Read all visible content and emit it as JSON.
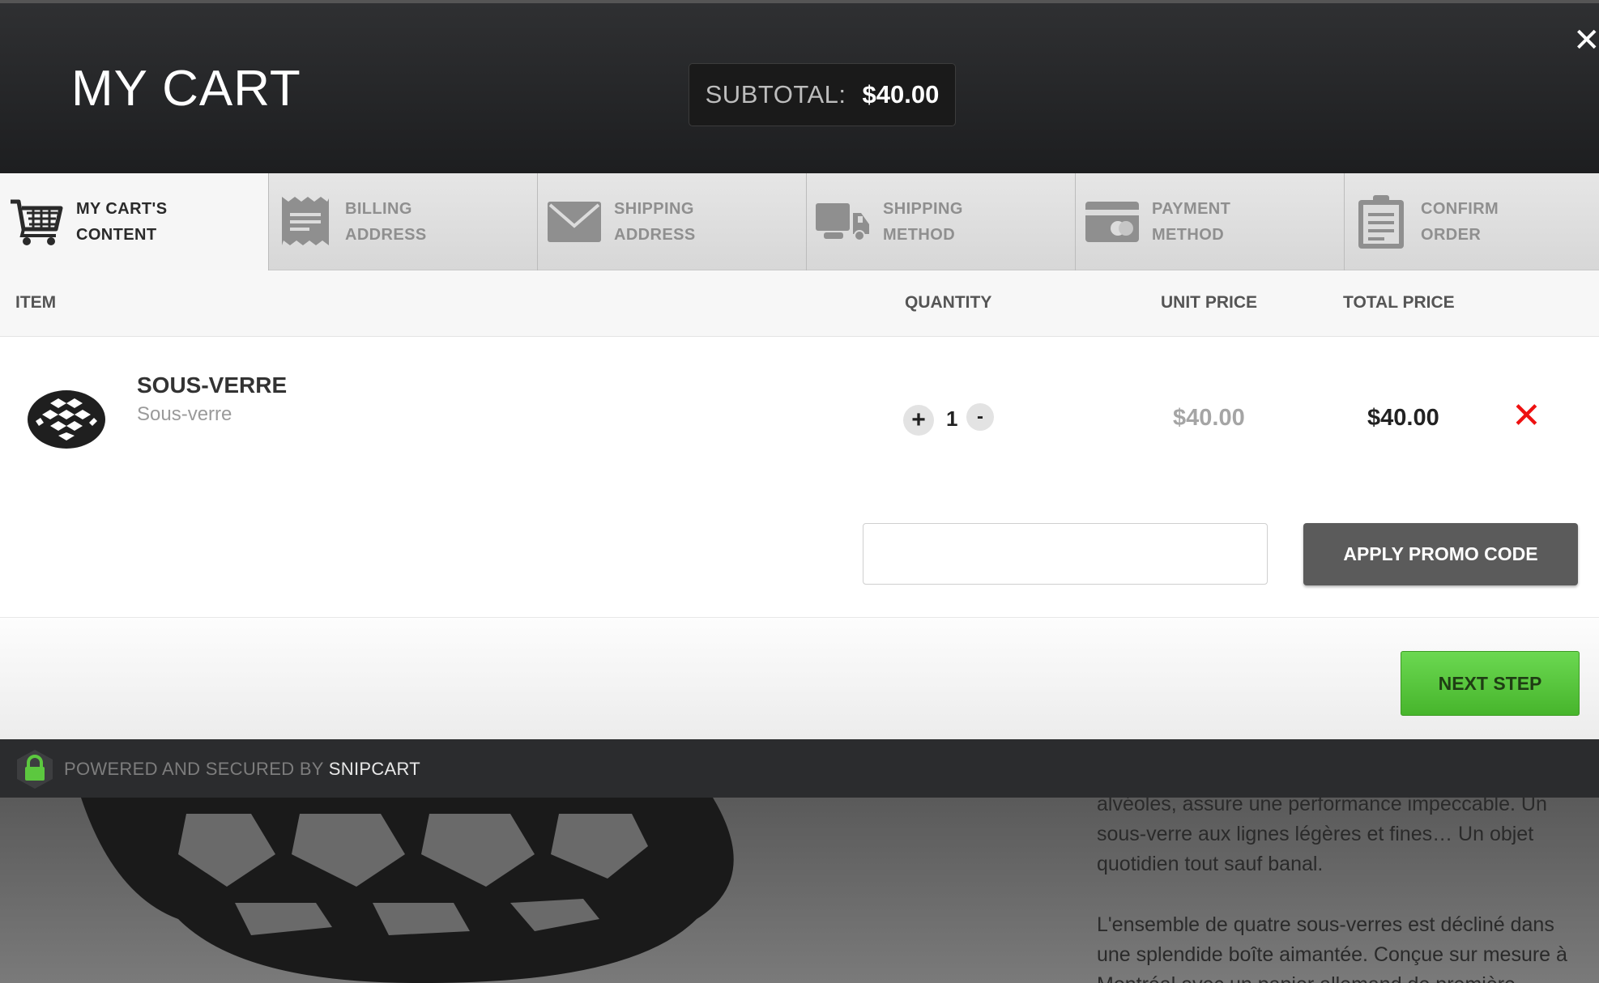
{
  "header": {
    "title": "MY CART",
    "subtotal_label": "SUBTOTAL:",
    "subtotal_value": "$40.00",
    "close_label": "✕"
  },
  "steps": [
    {
      "line1": "MY CART'S",
      "line2": "CONTENT",
      "icon": "cart-icon",
      "active": true
    },
    {
      "line1": "BILLING",
      "line2": "ADDRESS",
      "icon": "receipt-icon",
      "active": false
    },
    {
      "line1": "SHIPPING",
      "line2": "ADDRESS",
      "icon": "envelope-icon",
      "active": false
    },
    {
      "line1": "SHIPPING",
      "line2": "METHOD",
      "icon": "truck-icon",
      "active": false
    },
    {
      "line1": "PAYMENT",
      "line2": "METHOD",
      "icon": "credit-card-icon",
      "active": false
    },
    {
      "line1": "CONFIRM",
      "line2": "ORDER",
      "icon": "clipboard-icon",
      "active": false
    }
  ],
  "table": {
    "headers": {
      "item": "ITEM",
      "quantity": "QUANTITY",
      "unit_price": "UNIT PRICE",
      "total_price": "TOTAL PRICE"
    }
  },
  "items": [
    {
      "name": "SOUS-VERRE",
      "description": "Sous-verre",
      "quantity": "1",
      "unit_price": "$40.00",
      "total_price": "$40.00",
      "thumbnail_icon": "coaster-icon"
    }
  ],
  "controls": {
    "plus": "+",
    "minus": "-",
    "remove": "✕"
  },
  "promo": {
    "placeholder": "",
    "button_label": "APPLY PROMO CODE"
  },
  "next_step_label": "NEXT STEP",
  "footer": {
    "powered_text": "POWERED AND SECURED BY ",
    "brand": "SNIPCART",
    "icon": "lock-icon"
  },
  "background_text": {
    "paragraph1": "alvéoles, assure une performance impeccable. Un sous-verre aux lignes légères et fines… Un objet quotidien tout sauf banal.",
    "paragraph2": "L'ensemble de quatre sous-verres est décliné dans une splendide boîte aimantée. Conçue sur mesure à Montréal avec un papier allemand de première"
  },
  "colors": {
    "accent_green": "#5cc83f",
    "remove_red": "#ee1111",
    "header_dark": "#232426"
  }
}
